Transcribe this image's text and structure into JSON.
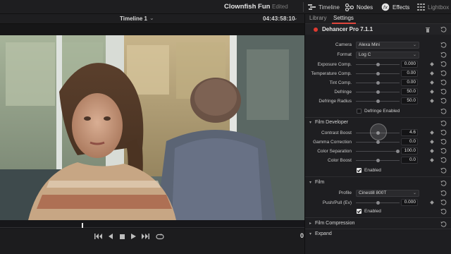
{
  "app": {
    "project_title": "Clownfish Fun",
    "project_status": "Edited",
    "toolbar": [
      {
        "label": "Timeline",
        "icon": "timeline-icon"
      },
      {
        "label": "Nodes",
        "icon": "nodes-icon"
      },
      {
        "label": "Effects",
        "icon": "effects-icon"
      },
      {
        "label": "Lightbox",
        "icon": "lightbox-icon"
      }
    ]
  },
  "viewer": {
    "timeline_name": "Timeline 1",
    "timecode": "04:43:58:10",
    "frame_number": "0"
  },
  "inspector": {
    "tabs": [
      {
        "label": "Library"
      },
      {
        "label": "Settings"
      }
    ],
    "plugin_name": "Dehancer Pro 7.1.1",
    "camera": {
      "label": "Camera",
      "value": "Alexa Mini"
    },
    "format": {
      "label": "Format",
      "value": "Log C"
    },
    "params": [
      {
        "label": "Exposure Comp.",
        "value": "0.000"
      },
      {
        "label": "Temperature Comp.",
        "value": "0.00"
      },
      {
        "label": "Tint Comp.",
        "value": "0.00"
      },
      {
        "label": "Defringe",
        "value": "50.0"
      },
      {
        "label": "Defringe Radius",
        "value": "50.0"
      }
    ],
    "defringe_enabled": {
      "label": "Defringe Enabled",
      "checked": false
    },
    "film_developer": {
      "title": "Film Developer",
      "params": [
        {
          "label": "Contrast Boost",
          "value": "4.6"
        },
        {
          "label": "Gamma Correction",
          "value": "0.0"
        },
        {
          "label": "Color Separation",
          "value": "100.0"
        },
        {
          "label": "Color Boost",
          "value": "0.0"
        }
      ],
      "enabled": {
        "label": "Enabled",
        "checked": true
      }
    },
    "film": {
      "title": "Film",
      "profile": {
        "label": "Profile",
        "value": "Cinestill 800T"
      },
      "push_pull": {
        "label": "Push/Pull (Ev)",
        "value": "0.000"
      },
      "enabled": {
        "label": "Enabled",
        "checked": true
      }
    },
    "film_compression": {
      "title": "Film Compression"
    },
    "expand": {
      "title": "Expand"
    }
  },
  "colors": {
    "accent": "#e0463c",
    "panel": "#1e1e21"
  }
}
